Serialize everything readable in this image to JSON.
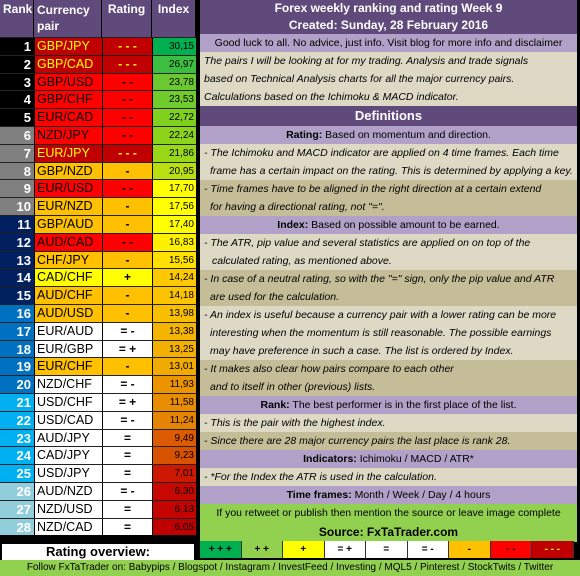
{
  "table": {
    "headers": {
      "rank": "Rank",
      "pair": "Currency pair",
      "rating": "Rating",
      "index": "Index"
    },
    "rows": [
      {
        "rank": "1",
        "pair": "GBP/JPY",
        "rating": "- - -",
        "index": "30,15",
        "rank_bg": "#000000",
        "pair_bg": "#c00000",
        "pair_fg": "#ffff00",
        "rating_bg": "#c00000",
        "rating_fg": "#ffff00",
        "index_bg": "#00b050"
      },
      {
        "rank": "2",
        "pair": "GBP/CAD",
        "rating": "- - -",
        "index": "26,97",
        "rank_bg": "#000000",
        "pair_bg": "#c00000",
        "pair_fg": "#ffff00",
        "rating_bg": "#c00000",
        "rating_fg": "#ffff00",
        "index_bg": "#3cbf40"
      },
      {
        "rank": "3",
        "pair": "GBP/USD",
        "rating": "- -",
        "index": "23,78",
        "rank_bg": "#000000",
        "pair_bg": "#ff0000",
        "pair_fg": "#000000",
        "rating_bg": "#ff0000",
        "rating_fg": "#000000",
        "index_bg": "#6cc830"
      },
      {
        "rank": "4",
        "pair": "GBP/CHF",
        "rating": "- -",
        "index": "23,53",
        "rank_bg": "#000000",
        "pair_bg": "#ff0000",
        "pair_fg": "#000000",
        "rating_bg": "#ff0000",
        "rating_fg": "#000000",
        "index_bg": "#70cc2c"
      },
      {
        "rank": "5",
        "pair": "EUR/CAD",
        "rating": "- -",
        "index": "22,72",
        "rank_bg": "#000000",
        "pair_bg": "#ff0000",
        "pair_fg": "#000000",
        "rating_bg": "#ff0000",
        "rating_fg": "#000000",
        "index_bg": "#80d020"
      },
      {
        "rank": "6",
        "pair": "NZD/JPY",
        "rating": "- -",
        "index": "22,24",
        "rank_bg": "#808080",
        "pair_bg": "#ff0000",
        "pair_fg": "#000000",
        "rating_bg": "#ff0000",
        "rating_fg": "#000000",
        "index_bg": "#8cd41c"
      },
      {
        "rank": "7",
        "pair": "EUR/JPY",
        "rating": "- - -",
        "index": "21,86",
        "rank_bg": "#808080",
        "pair_bg": "#c00000",
        "pair_fg": "#ffff00",
        "rating_bg": "#c00000",
        "rating_fg": "#ffff00",
        "index_bg": "#98d818"
      },
      {
        "rank": "8",
        "pair": "GBP/NZD",
        "rating": "-",
        "index": "20,95",
        "rank_bg": "#808080",
        "pair_bg": "#ffc000",
        "pair_fg": "#000000",
        "rating_bg": "#ffc000",
        "rating_fg": "#000000",
        "index_bg": "#b8e010"
      },
      {
        "rank": "9",
        "pair": "EUR/USD",
        "rating": "- -",
        "index": "17,70",
        "rank_bg": "#808080",
        "pair_bg": "#ff0000",
        "pair_fg": "#000000",
        "rating_bg": "#ff0000",
        "rating_fg": "#000000",
        "index_bg": "#ffff00"
      },
      {
        "rank": "10",
        "pair": "EUR/NZD",
        "rating": "-",
        "index": "17,56",
        "rank_bg": "#808080",
        "pair_bg": "#ffc000",
        "pair_fg": "#000000",
        "rating_bg": "#ffc000",
        "rating_fg": "#000000",
        "index_bg": "#ffff00"
      },
      {
        "rank": "11",
        "pair": "GBP/AUD",
        "rating": "-",
        "index": "17,40",
        "rank_bg": "#002060",
        "pair_bg": "#ffc000",
        "pair_fg": "#000000",
        "rating_bg": "#ffc000",
        "rating_fg": "#000000",
        "index_bg": "#ffff00"
      },
      {
        "rank": "12",
        "pair": "AUD/CAD",
        "rating": "- -",
        "index": "16,83",
        "rank_bg": "#002060",
        "pair_bg": "#ff0000",
        "pair_fg": "#000000",
        "rating_bg": "#ff0000",
        "rating_fg": "#000000",
        "index_bg": "#fff000"
      },
      {
        "rank": "13",
        "pair": "CHF/JPY",
        "rating": "-",
        "index": "15,56",
        "rank_bg": "#002060",
        "pair_bg": "#ffc000",
        "pair_fg": "#000000",
        "rating_bg": "#ffc000",
        "rating_fg": "#000000",
        "index_bg": "#ffe000"
      },
      {
        "rank": "14",
        "pair": "CAD/CHF",
        "rating": "+",
        "index": "14,24",
        "rank_bg": "#002060",
        "pair_bg": "#ffff00",
        "pair_fg": "#000000",
        "rating_bg": "#ffff00",
        "rating_fg": "#000000",
        "index_bg": "#fcc800"
      },
      {
        "rank": "15",
        "pair": "AUD/CHF",
        "rating": "-",
        "index": "14,18",
        "rank_bg": "#002060",
        "pair_bg": "#ffc000",
        "pair_fg": "#000000",
        "rating_bg": "#ffc000",
        "rating_fg": "#000000",
        "index_bg": "#fcc400"
      },
      {
        "rank": "16",
        "pair": "AUD/USD",
        "rating": "-",
        "index": "13,98",
        "rank_bg": "#0070c0",
        "pair_bg": "#ffc000",
        "pair_fg": "#000000",
        "rating_bg": "#ffc000",
        "rating_fg": "#000000",
        "index_bg": "#f8be00"
      },
      {
        "rank": "17",
        "pair": "EUR/AUD",
        "rating": "= -",
        "index": "13,38",
        "rank_bg": "#0070c0",
        "pair_bg": "#ffffff",
        "pair_fg": "#000000",
        "rating_bg": "#ffffff",
        "rating_fg": "#000000",
        "index_bg": "#f4b400"
      },
      {
        "rank": "18",
        "pair": "EUR/GBP",
        "rating": "= +",
        "index": "13,25",
        "rank_bg": "#0070c0",
        "pair_bg": "#ffffff",
        "pair_fg": "#000000",
        "rating_bg": "#ffffff",
        "rating_fg": "#000000",
        "index_bg": "#f4b000"
      },
      {
        "rank": "19",
        "pair": "EUR/CHF",
        "rating": "-",
        "index": "13,01",
        "rank_bg": "#0070c0",
        "pair_bg": "#ffc000",
        "pair_fg": "#000000",
        "rating_bg": "#ffc000",
        "rating_fg": "#000000",
        "index_bg": "#f0aa00"
      },
      {
        "rank": "20",
        "pair": "NZD/CHF",
        "rating": "= -",
        "index": "11,93",
        "rank_bg": "#0070c0",
        "pair_bg": "#ffffff",
        "pair_fg": "#000000",
        "rating_bg": "#ffffff",
        "rating_fg": "#000000",
        "index_bg": "#ec9400"
      },
      {
        "rank": "21",
        "pair": "USD/CHF",
        "rating": "= +",
        "index": "11,58",
        "rank_bg": "#00b0f0",
        "pair_bg": "#ffffff",
        "pair_fg": "#000000",
        "rating_bg": "#ffffff",
        "rating_fg": "#000000",
        "index_bg": "#e88c00"
      },
      {
        "rank": "22",
        "pair": "USD/CAD",
        "rating": "= -",
        "index": "11,24",
        "rank_bg": "#00b0f0",
        "pair_bg": "#ffffff",
        "pair_fg": "#000000",
        "rating_bg": "#ffffff",
        "rating_fg": "#000000",
        "index_bg": "#e48400"
      },
      {
        "rank": "23",
        "pair": "AUD/JPY",
        "rating": "=",
        "index": "9,49",
        "rank_bg": "#00b0f0",
        "pair_bg": "#ffffff",
        "pair_fg": "#000000",
        "rating_bg": "#ffffff",
        "rating_fg": "#000000",
        "index_bg": "#dc5a00"
      },
      {
        "rank": "24",
        "pair": "CAD/JPY",
        "rating": "=",
        "index": "9,23",
        "rank_bg": "#00b0f0",
        "pair_bg": "#ffffff",
        "pair_fg": "#000000",
        "rating_bg": "#ffffff",
        "rating_fg": "#000000",
        "index_bg": "#d85200"
      },
      {
        "rank": "25",
        "pair": "USD/JPY",
        "rating": "=",
        "index": "7,01",
        "rank_bg": "#00b0f0",
        "pair_bg": "#ffffff",
        "pair_fg": "#000000",
        "rating_bg": "#ffffff",
        "rating_fg": "#000000",
        "index_bg": "#cc1800"
      },
      {
        "rank": "26",
        "pair": "AUD/NZD",
        "rating": "= -",
        "index": "6,30",
        "rank_bg": "#92cddc",
        "pair_bg": "#ffffff",
        "pair_fg": "#000000",
        "rating_bg": "#ffffff",
        "rating_fg": "#000000",
        "index_bg": "#c80800"
      },
      {
        "rank": "27",
        "pair": "NZD/USD",
        "rating": "=",
        "index": "6,13",
        "rank_bg": "#92cddc",
        "pair_bg": "#ffffff",
        "pair_fg": "#000000",
        "rating_bg": "#ffffff",
        "rating_fg": "#000000",
        "index_bg": "#c40400"
      },
      {
        "rank": "28",
        "pair": "NZD/CAD",
        "rating": "=",
        "index": "6,05",
        "rank_bg": "#92cddc",
        "pair_bg": "#ffffff",
        "pair_fg": "#000000",
        "rating_bg": "#ffffff",
        "rating_fg": "#000000",
        "index_bg": "#c00000"
      }
    ]
  },
  "info": {
    "title": "Forex weekly ranking and rating Week 9",
    "created": "Created: Sunday, 28 February 2016",
    "disclaimer": "Good luck to all. No advice, just info. Visit blog for more info and disclaimer",
    "intro": [
      "The pairs I will be looking at for my trading. Analysis and trade signals",
      "based on Technical Analysis charts for all the major currency pairs.",
      "Calculations based on the Ichimoku & MACD indicator."
    ],
    "definitions_title": "Definitions",
    "rating_label": "Rating:",
    "rating_text": " Based on momentum and direction.",
    "rating_notes_a": [
      "- The Ichimoku and MACD indicator are applied on 4 time frames. Each time",
      "  frame has a certain impact on the rating. This is determined by applying a key."
    ],
    "rating_notes_b": [
      "- Time frames have to be aligned in the right direction at  a certain extend",
      "  for having a directional rating, not \"=\"."
    ],
    "index_label": "Index:",
    "index_text": " Based on possible amount to be earned.",
    "index_notes_a": [
      "- The ATR, pip value and several statistics are applied on on top of the",
      "   calculated rating, as mentioned above."
    ],
    "index_notes_b": [
      "- In case of a neutral rating, so with the \"=\" sign, only the pip value and ATR",
      "  are used for the calculation."
    ],
    "index_notes_c": [
      "- An index is useful because a currency pair with a lower rating can be more",
      "  interesting when the momentum is still reasonable. The possible earnings",
      "  may have preference in such a case. The list is ordered by Index."
    ],
    "index_notes_d": [
      "- It makes also clear how pairs compare to each other",
      "  and to itself in other (previous) lists."
    ],
    "rank_label": "Rank:",
    "rank_text": " The best performer is in the first place of the list.",
    "rank_note_a": "-  This is the pair with the highest index.",
    "rank_note_b": "-  Since there are 28 major currency pairs the last place is rank 28.",
    "indicators_label": "Indicators:",
    "indicators_text": " Ichimoku / MACD / ATR*",
    "indicators_note": "- *For the Index the ATR is used in the calculation.",
    "timeframes_label": "Time frames:",
    "timeframes_text": " Month / Week / Day / 4 hours",
    "retweet": "If you retweet or publish then mention the source or leave image complete",
    "source": "Source: FxTaTrader.com"
  },
  "legend": {
    "title": "Rating overview:",
    "items": [
      {
        "label": "+ + +",
        "bg": "#00b050",
        "fg": "#000000"
      },
      {
        "label": "+ +",
        "bg": "#92d050",
        "fg": "#000000"
      },
      {
        "label": "+",
        "bg": "#ffff00",
        "fg": "#000000"
      },
      {
        "label": "= +",
        "bg": "#ffffff",
        "fg": "#000000"
      },
      {
        "label": "=",
        "bg": "#ffffff",
        "fg": "#000000"
      },
      {
        "label": "= -",
        "bg": "#ffffff",
        "fg": "#000000"
      },
      {
        "label": "-",
        "bg": "#ffc000",
        "fg": "#000000"
      },
      {
        "label": "- -",
        "bg": "#ff0000",
        "fg": "#000000"
      },
      {
        "label": "- - -",
        "bg": "#c00000",
        "fg": "#ffff00"
      }
    ]
  },
  "footer": "Follow FxTaTrader on: Babypips / Blogspot / Instagram / InvestFeed / Investing / MQL5 / Pinterest / StockTwits / Twitter"
}
